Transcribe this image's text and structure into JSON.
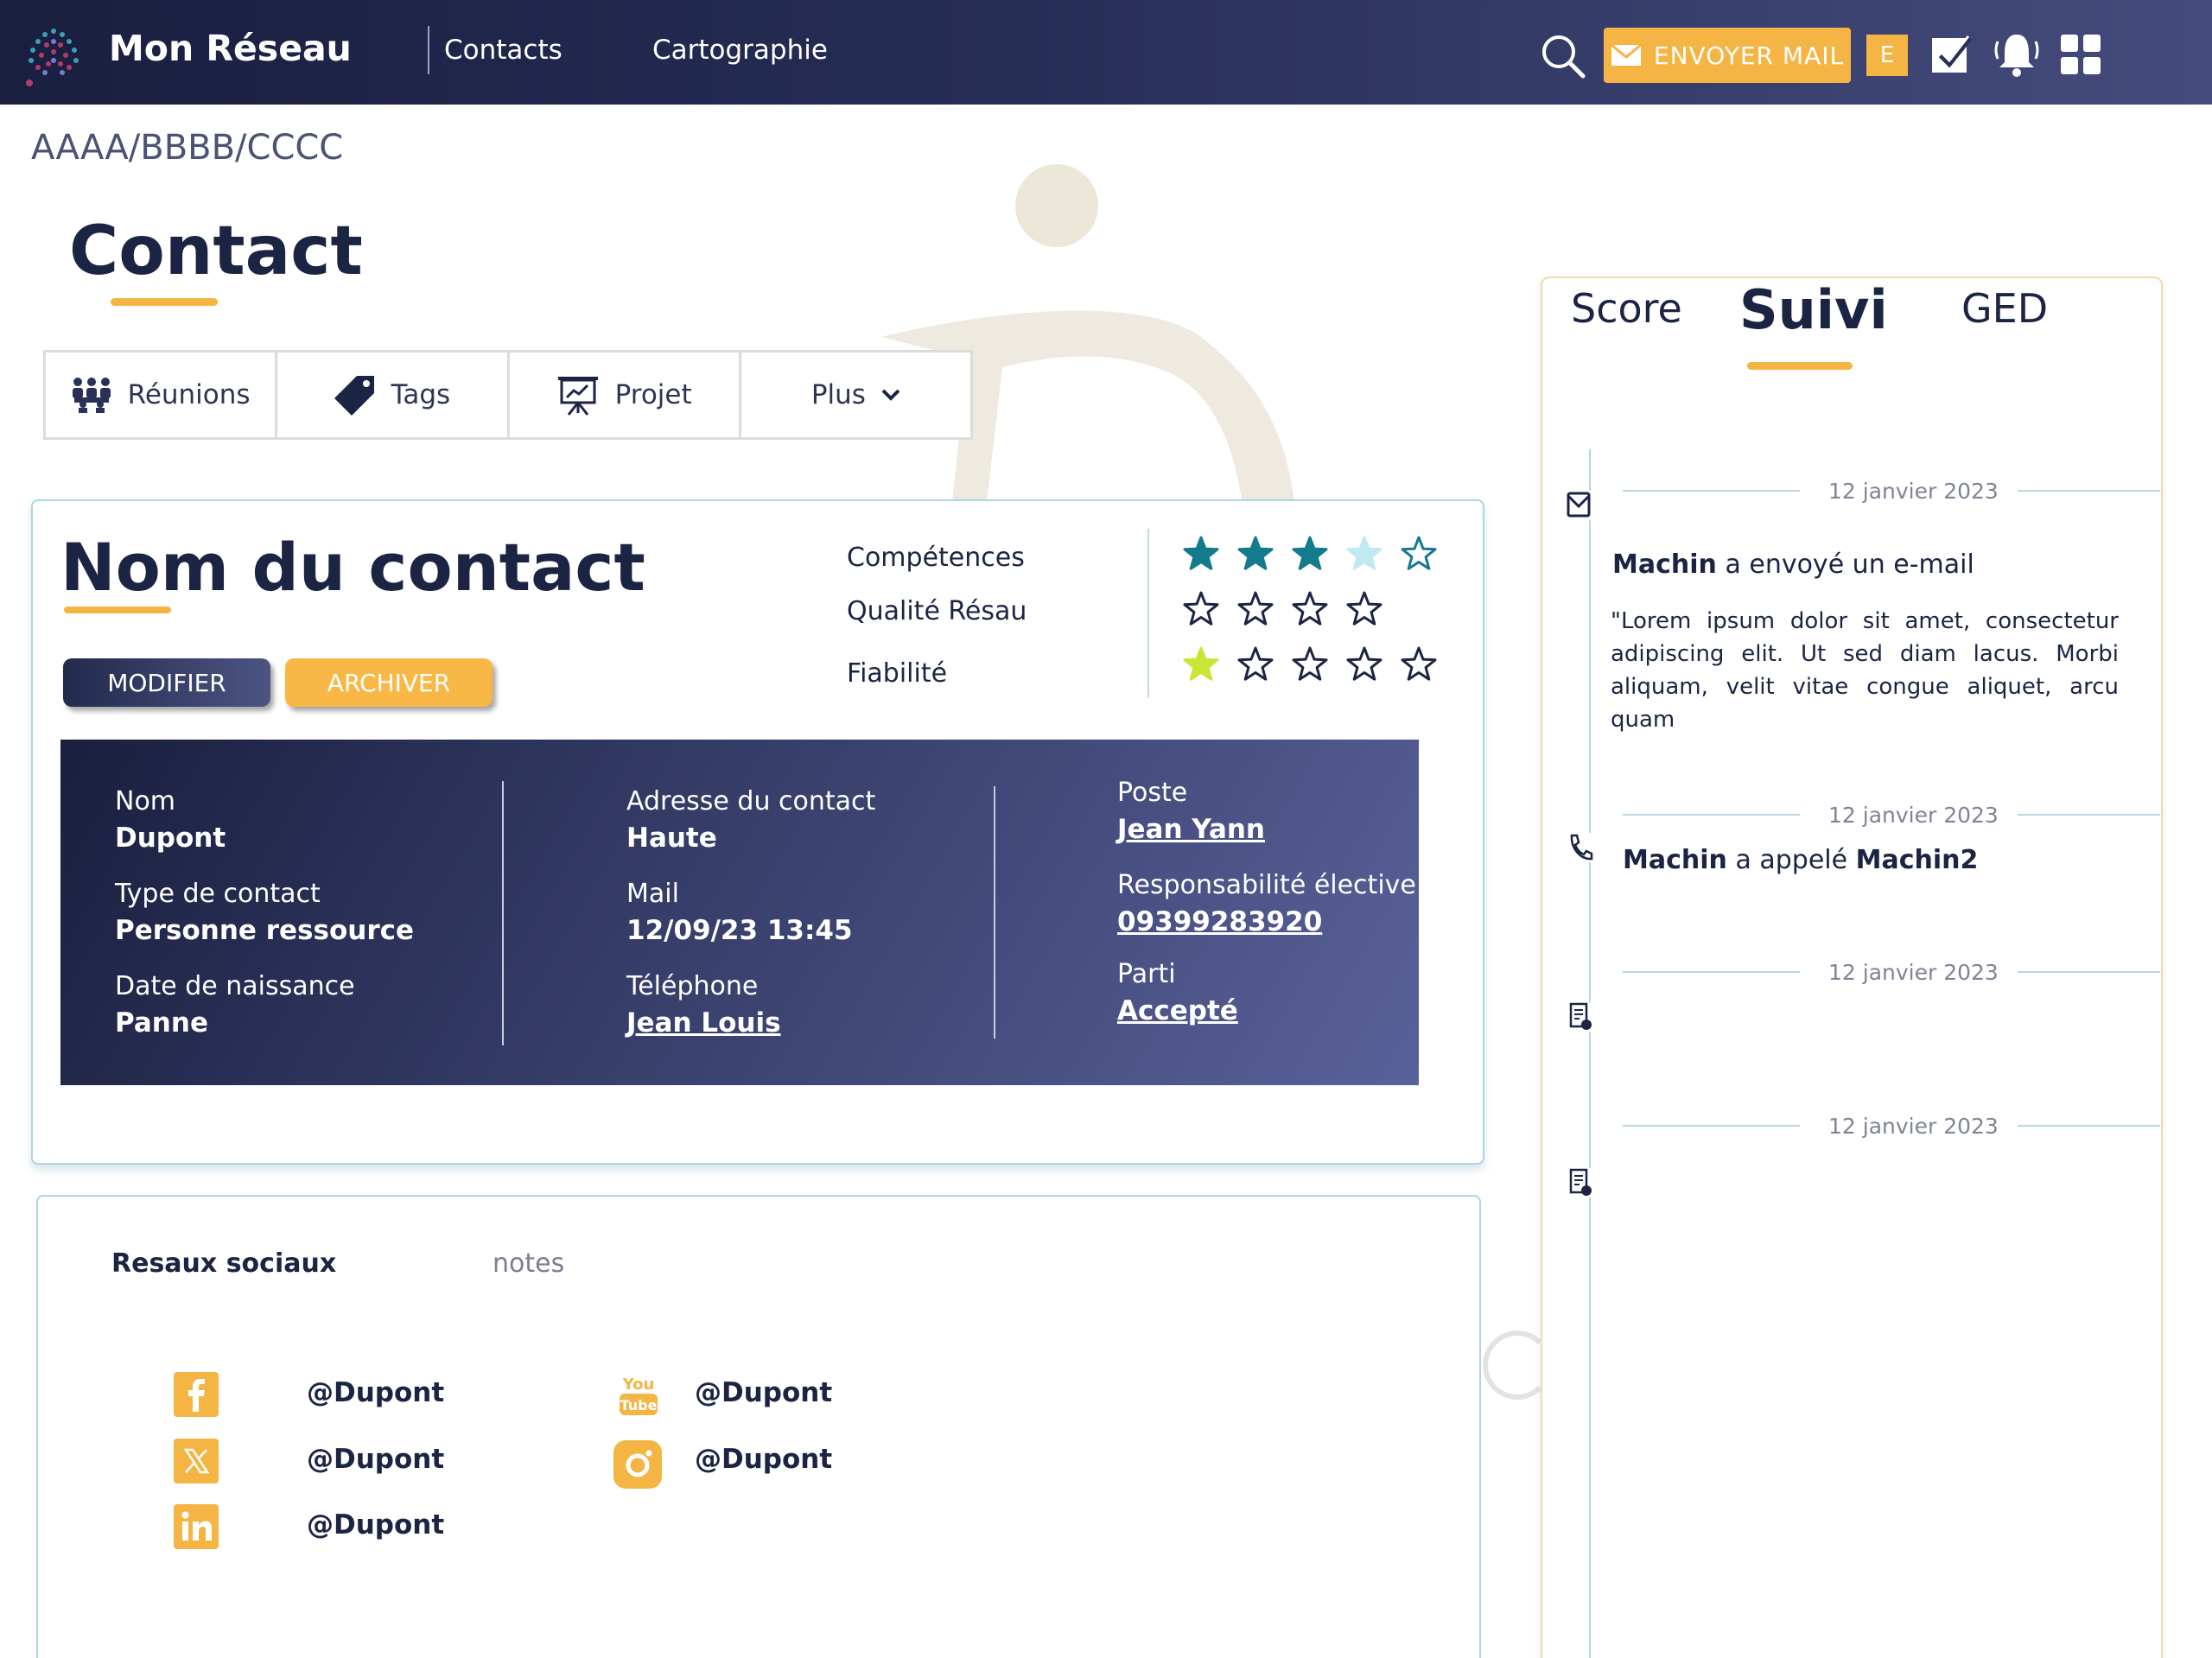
{
  "app": {
    "title": "Mon Réseau"
  },
  "nav": {
    "contacts": "Contacts",
    "cartographie": "Cartographie"
  },
  "toolbar": {
    "send_mail_label": "ENVOYER MAIL",
    "user_initial": "E"
  },
  "breadcrumb": "AAAA/BBBB/CCCC",
  "page_title": "Contact",
  "tabs": [
    {
      "label": "Réunions",
      "icon": "meeting-icon"
    },
    {
      "label": "Tags",
      "icon": "tag-icon"
    },
    {
      "label": "Projet",
      "icon": "presentation-icon"
    },
    {
      "label": "Plus",
      "icon": "chevron-down-icon"
    }
  ],
  "contact": {
    "name": "Nom du contact",
    "modify_label": "MODIFIER",
    "archive_label": "ARCHIVER",
    "ratings": [
      {
        "label": "Compétences",
        "value": 3.5,
        "max": 5
      },
      {
        "label": "Qualité Résau",
        "value": 0,
        "max": 4
      },
      {
        "label": "Fiabilité",
        "value": 1,
        "max": 5
      }
    ],
    "info": {
      "nom_label": "Nom",
      "nom_value": "Dupont",
      "type_label": "Type de contact",
      "type_value": "Personne ressource",
      "naissance_label": "Date de naissance",
      "naissance_value": "Panne",
      "adresse_label": "Adresse du contact",
      "adresse_value": "Haute",
      "mail_label": "Mail",
      "mail_value": "12/09/23 13:45",
      "telephone_label": "Téléphone",
      "telephone_value": "Jean Louis",
      "poste_label": "Poste",
      "poste_value": "Jean Yann",
      "responsabilite_label": "Responsabilité élective",
      "responsabilite_value": "09399283920",
      "parti_label": "Parti",
      "parti_value": "Accepté"
    }
  },
  "social": {
    "heading": "Resaux sociaux",
    "notes_tab": "notes",
    "accounts": [
      {
        "network": "facebook-icon",
        "handle": "@Dupont"
      },
      {
        "network": "x-icon",
        "handle": "@Dupont"
      },
      {
        "network": "linkedin-icon",
        "handle": "@Dupont"
      },
      {
        "network": "youtube-icon",
        "handle": "@Dupont"
      },
      {
        "network": "instagram-icon",
        "handle": "@Dupont"
      }
    ]
  },
  "right_panel": {
    "tabs": {
      "score": "Score",
      "suivi": "Suivi",
      "ged": "GED"
    },
    "events": [
      {
        "date": "12 janvier 2023",
        "icon": "mail-icon",
        "actor": "Machin",
        "action": "a envoyé un e-mail",
        "body": "\"Lorem ipsum dolor sit amet, consectetur adipiscing elit. Ut sed diam lacus. Morbi aliquam, velit vitae congue aliquet, arcu quam"
      },
      {
        "date": "12 janvier 2023",
        "icon": "phone-icon",
        "actor": "Machin",
        "action": "a appelé",
        "target": "Machin2"
      },
      {
        "date": "12 janvier 2023",
        "icon": "document-icon"
      },
      {
        "date": "12 janvier 2023",
        "icon": "document-icon"
      }
    ]
  },
  "colors": {
    "accent": "#f5b544",
    "navy": "#1b2443",
    "star": "#137b8c",
    "star_light": "#bfeaf2",
    "star_green": "#c8e635"
  }
}
